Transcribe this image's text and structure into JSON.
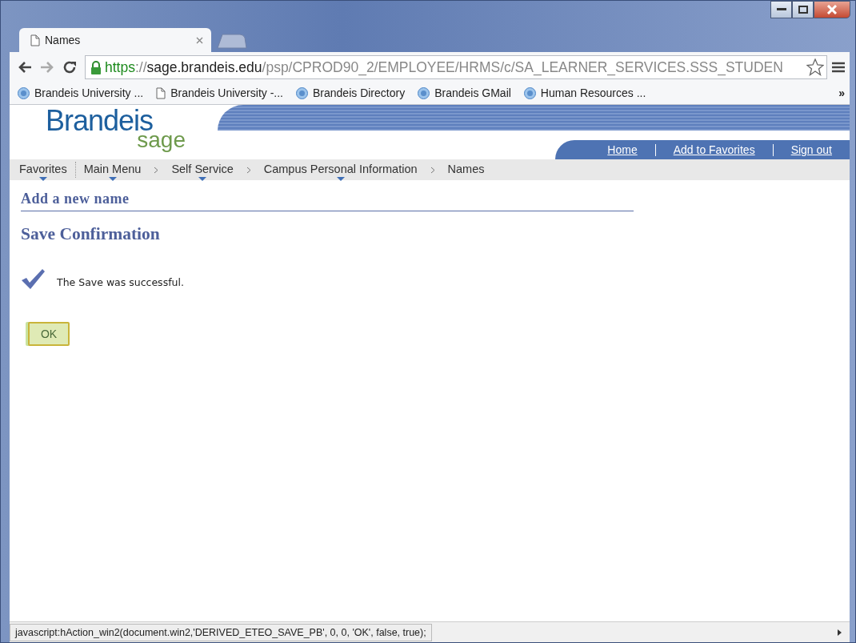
{
  "browser": {
    "tabs": [
      {
        "title": "Names",
        "selected": true
      }
    ],
    "address": [
      {
        "kind": "scheme",
        "text": "https"
      },
      {
        "kind": "punct",
        "text": "://"
      },
      {
        "kind": "host",
        "text": "sage.brandeis.edu"
      },
      {
        "kind": "path",
        "text": "/psp/CPROD90_2/EMPLOYEE/HRMS/c/SA_LEARNER_SERVICES.SSS_STUDEN"
      }
    ],
    "bookmarks": [
      {
        "label": "Brandeis University ...",
        "kind": "site"
      },
      {
        "label": "Brandeis University -...",
        "kind": "page"
      },
      {
        "label": "Brandeis Directory",
        "kind": "site"
      },
      {
        "label": "Brandeis GMail",
        "kind": "site"
      },
      {
        "label": "Human Resources ...",
        "kind": "site"
      }
    ],
    "bookmarks_more": "»",
    "status_bar": "javascript:hAction_win2(document.win2,'DERIVED_ETEO_SAVE_PB', 0, 0, 'OK', false, true);"
  },
  "page": {
    "logo": {
      "word": "Brandeis",
      "sub": "sage"
    },
    "header_links": [
      "Home",
      "Add to Favorites",
      "Sign out"
    ],
    "breadcrumbs": [
      {
        "label": "Favorites",
        "menu": true
      },
      {
        "label": "Main Menu",
        "menu": true
      },
      {
        "label": "Self Service",
        "menu": true
      },
      {
        "label": "Campus Personal Information",
        "menu": true
      },
      {
        "label": "Names",
        "menu": false
      }
    ],
    "section_title": "Add a new name",
    "heading": "Save Confirmation",
    "message": "The Save was successful.",
    "ok_button": "OK"
  }
}
